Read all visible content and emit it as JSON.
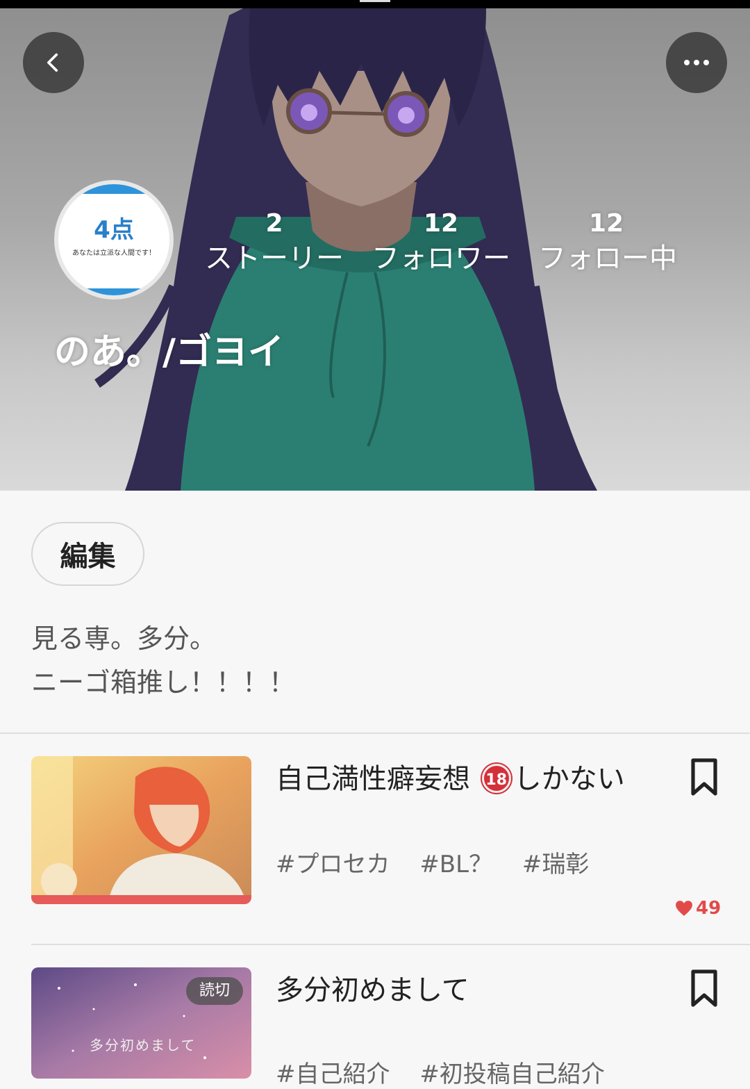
{
  "header": {
    "back_icon": "chevron-left-icon",
    "more_icon": "more-horizontal-icon"
  },
  "profile": {
    "avatar": {
      "score": "4点",
      "caption": "あなたは立派な人間です！"
    },
    "stats": {
      "stories": {
        "count": "2",
        "label": "ストーリー"
      },
      "followers": {
        "count": "12",
        "label": "フォロワー"
      },
      "following": {
        "count": "12",
        "label": "フォロー中"
      }
    },
    "username": "のあ。/ゴヨイ",
    "edit_label": "編集",
    "bio_lines": [
      "見る専。多分。",
      "ニーゴ箱推し！！！！"
    ]
  },
  "stories": [
    {
      "title_before": "自己満性癖妄想",
      "badge": "18",
      "title_after": "しかない",
      "tags": [
        "#プロセカ",
        "#BL？",
        "#瑞彰"
      ],
      "likes": "49",
      "bookmark_icon": "bookmark-icon"
    },
    {
      "title": "多分初めまして",
      "read_badge": "読切",
      "thumb_caption": "多分初めまして",
      "tags": [
        "#自己紹介",
        "#初投稿自己紹介"
      ],
      "bookmark_icon": "bookmark-icon"
    }
  ],
  "colors": {
    "like_red": "#e24a4a",
    "progress_red": "#e65a5a",
    "hoodie_teal": "#2b7f72",
    "hair_navy": "#322c52"
  }
}
